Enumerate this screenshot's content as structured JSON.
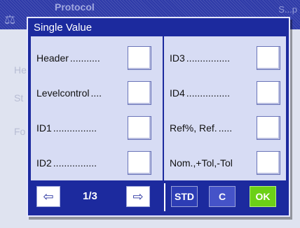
{
  "background": {
    "title": "Protocol",
    "title_right": "S...p",
    "items": [
      "He",
      "St",
      "Fo"
    ]
  },
  "dialog": {
    "title": "Single Value",
    "left_items": [
      {
        "label": "Header",
        "dots": "..........."
      },
      {
        "label": "Levelcontrol",
        "dots": "...."
      },
      {
        "label": "ID1",
        "dots": "................"
      },
      {
        "label": "ID2",
        "dots": "................"
      }
    ],
    "right_items": [
      {
        "label": "ID3",
        "dots": "................"
      },
      {
        "label": "ID4",
        "dots": "................"
      },
      {
        "label": "Ref%, Ref.",
        "dots": "....."
      },
      {
        "label": "Nom.,+Tol,-Tol",
        "dots": ""
      }
    ]
  },
  "footer": {
    "prev_icon": "arrow-left-icon",
    "next_icon": "arrow-right-icon",
    "page": "1/3",
    "std_label": "STD",
    "c_label": "C",
    "ok_label": "OK"
  },
  "colors": {
    "dialog_bg": "#1c2a9e",
    "body_bg": "#d7dcf4",
    "ok": "#6cd016"
  }
}
